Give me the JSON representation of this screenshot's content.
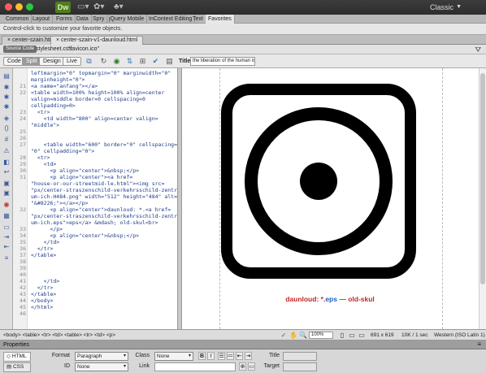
{
  "titlebar": {
    "app_logo": "Dw",
    "workspace": "Classic",
    "colors": {
      "close": "#ff5f57",
      "minimize": "#febc2e",
      "maximize": "#28c840",
      "logo_bg": "#4e7d1e"
    }
  },
  "insert_tabs": [
    "Common",
    "Layout",
    "Forms",
    "Data",
    "Spry",
    "jQuery Mobile",
    "InContext Editing",
    "Text",
    "Favorites"
  ],
  "insert_hint": "Control-click to customize your favorite objects.",
  "doc_tabs": [
    "center-szain.html",
    "center-szain-v1-daunloud.html"
  ],
  "related_files": {
    "source_code": "Source Code",
    "files": [
      "stylesheet.css",
      "\"favicon.ico\""
    ]
  },
  "doc_toolbar": {
    "views": [
      "Code",
      "Split",
      "Design",
      "Live"
    ],
    "title_label": "Title:",
    "title_value": "the liberation of the human is"
  },
  "code": {
    "lines": [
      {
        "n": "",
        "t": "leftmargin=\"0\" topmargin=\"0\" marginwidth=\"0\""
      },
      {
        "n": "",
        "t": "marginheight=\"0\">"
      },
      {
        "n": "21",
        "t": "<a name=\"anfang\"></a>"
      },
      {
        "n": "22",
        "t": "<table width=100% height=100% align=center"
      },
      {
        "n": "",
        "t": "valign=middle border=0 cellspacing=0"
      },
      {
        "n": "",
        "t": "cellpadding=0>"
      },
      {
        "n": "23",
        "t": "  <tr>"
      },
      {
        "n": "24",
        "t": "    <td width=\"800\" align=center valign="
      },
      {
        "n": "",
        "t": "\"middle\">"
      },
      {
        "n": "25",
        "t": ""
      },
      {
        "n": "26",
        "t": ""
      },
      {
        "n": "27",
        "t": "    <table width=\"600\" border=\"0\" cellspacing="
      },
      {
        "n": "",
        "t": "\"0\" cellpadding=\"0\">"
      },
      {
        "n": "28",
        "t": "  <tr>"
      },
      {
        "n": "29",
        "t": "    <td>"
      },
      {
        "n": "30",
        "t": "      <p align=\"center\">&nbsp;</p>"
      },
      {
        "n": "31",
        "t": "      <p align=\"center\"><a href="
      },
      {
        "n": "",
        "t": "\"house-or-our-streetmid-le.html\"><img src="
      },
      {
        "n": "",
        "t": "\"px/center-straszenschild-verkehrsschild-zentr"
      },
      {
        "n": "",
        "t": "um-ich-H484.png\" width=\"512\" height=\"484\" alt="
      },
      {
        "n": "",
        "t": "\"&#8226;\"></a></p>"
      },
      {
        "n": "32",
        "t": "      <p align=\"center\">daunloud: *.<a href="
      },
      {
        "n": "",
        "t": "\"px/center-straszenschild-verkehrsschild-zentr"
      },
      {
        "n": "",
        "t": "um-ich.eps\">eps</a> &mdash; old-skul<br>"
      },
      {
        "n": "33",
        "t": "      </p>"
      },
      {
        "n": "34",
        "t": "      <p align=\"center\">&nbsp;</p>"
      },
      {
        "n": "35",
        "t": "    </td>"
      },
      {
        "n": "36",
        "t": "  </tr>"
      },
      {
        "n": "37",
        "t": "</table>"
      },
      {
        "n": "38",
        "t": ""
      },
      {
        "n": "39",
        "t": ""
      },
      {
        "n": "40",
        "t": ""
      },
      {
        "n": "41",
        "t": "    </td>"
      },
      {
        "n": "42",
        "t": "  </tr>"
      },
      {
        "n": "43",
        "t": "</table>"
      },
      {
        "n": "44",
        "t": "</body>"
      },
      {
        "n": "45",
        "t": "</html>"
      },
      {
        "n": "46",
        "t": ""
      }
    ]
  },
  "design": {
    "caption_prefix": "daunloud: *.",
    "caption_link": "eps",
    "caption_suffix": " — old-skul"
  },
  "status_bar": {
    "tag_selector": "<body> <table> <tr> <td> <table> <tr> <td> <p>",
    "zoom": "100%",
    "dimensions": "691 x 619",
    "size_time": "10K / 1 sec",
    "encoding": "Western (ISO Latin 1)"
  },
  "properties": {
    "title": "Properties",
    "html_btn": "HTML",
    "css_btn": "CSS",
    "format_label": "Format",
    "format_value": "Paragraph",
    "class_label": "Class",
    "class_value": "None",
    "id_label": "ID",
    "id_value": "None",
    "link_label": "Link",
    "title_label": "Title",
    "target_label": "Target",
    "bold": "B",
    "italic": "I"
  }
}
